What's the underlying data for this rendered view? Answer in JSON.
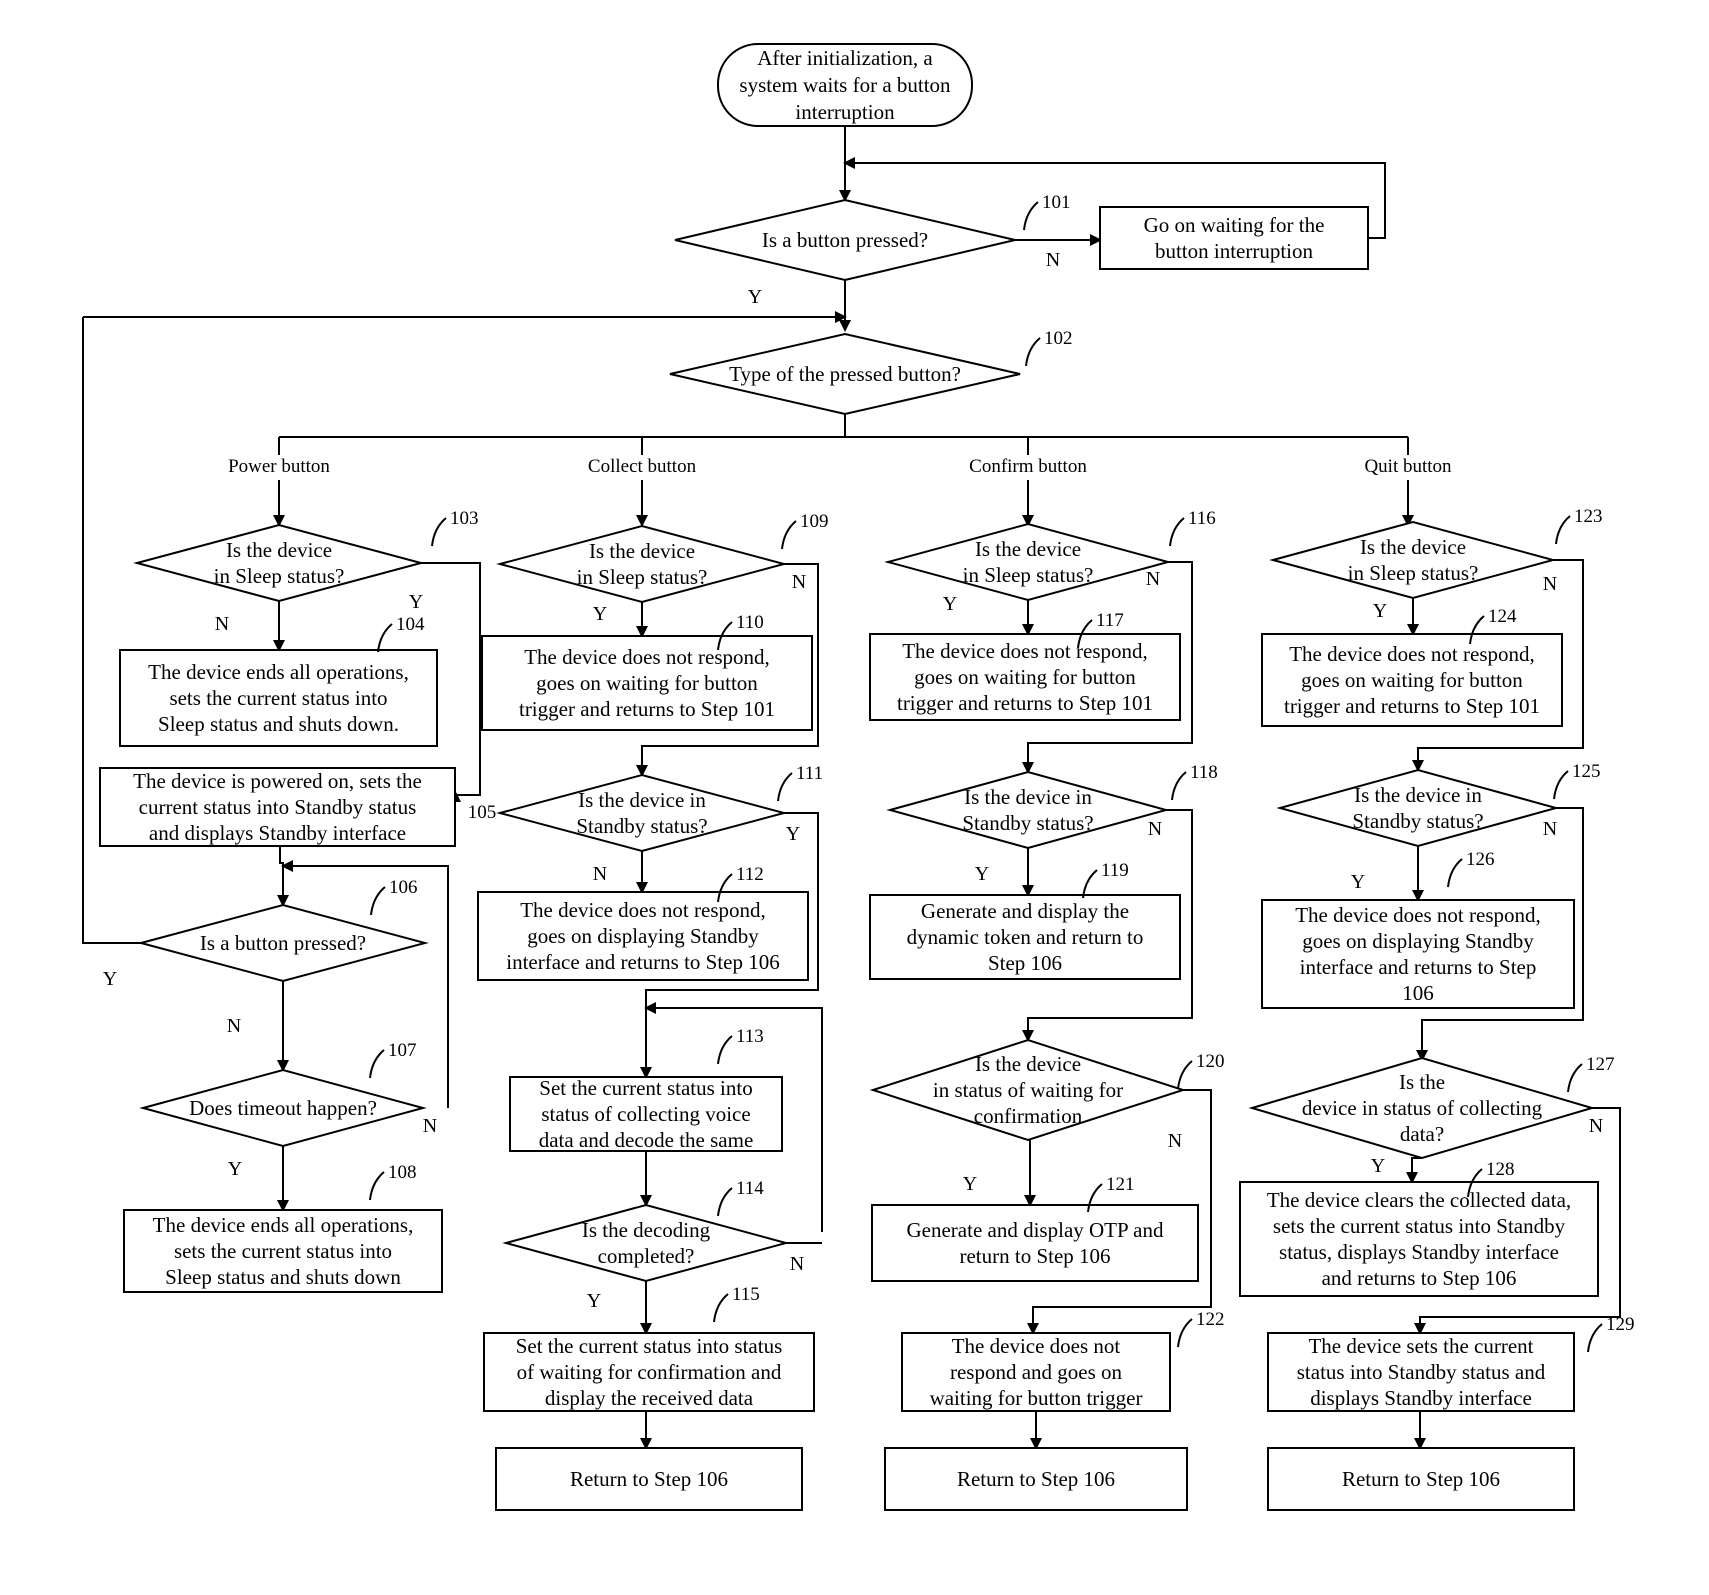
{
  "diagram": {
    "start": {
      "lines": [
        "After initialization, a",
        "system waits for a button",
        "interruption"
      ]
    },
    "n101": {
      "ref": "101",
      "lines": [
        "Is a button pressed?"
      ]
    },
    "wait": {
      "lines": [
        "Go on waiting for the",
        "button interruption"
      ]
    },
    "n102": {
      "ref": "102",
      "lines": [
        "Type of the pressed button?"
      ]
    },
    "branches": {
      "power": "Power button",
      "collect": "Collect button",
      "confirm": "Confirm button",
      "quit": "Quit button"
    },
    "n103": {
      "ref": "103",
      "lines": [
        "Is the device",
        "in Sleep status?"
      ]
    },
    "n104": {
      "ref": "104",
      "lines": [
        "The device ends all operations,",
        "sets the current status into",
        "Sleep status and shuts down."
      ]
    },
    "n105": {
      "ref": "105",
      "lines": [
        "The device is powered on, sets the",
        "current status into Standby status",
        "and displays Standby interface"
      ]
    },
    "n106": {
      "ref": "106",
      "lines": [
        "Is a button pressed?"
      ]
    },
    "n107": {
      "ref": "107",
      "lines": [
        "Does timeout happen?"
      ]
    },
    "n108": {
      "ref": "108",
      "lines": [
        "The device ends all operations,",
        "sets the current status into",
        "Sleep status and shuts down"
      ]
    },
    "n109": {
      "ref": "109",
      "lines": [
        "Is the device",
        "in Sleep status?"
      ]
    },
    "n110": {
      "ref": "110",
      "lines": [
        "The device does not respond,",
        "goes on waiting for button",
        "trigger and returns to Step 101"
      ]
    },
    "n111": {
      "ref": "111",
      "lines": [
        "Is the device in",
        "Standby status?"
      ]
    },
    "n112": {
      "ref": "112",
      "lines": [
        "The device does not respond,",
        "goes on displaying Standby",
        "interface and returns to Step 106"
      ]
    },
    "n113": {
      "ref": "113",
      "lines": [
        "Set the current status into",
        "status of collecting voice",
        "data and decode the same"
      ]
    },
    "n114": {
      "ref": "114",
      "lines": [
        "Is the decoding",
        "completed?"
      ]
    },
    "n115": {
      "ref": "115",
      "lines": [
        "Set the current status into status",
        "of waiting for confirmation and",
        "display the received data"
      ]
    },
    "ret1": {
      "lines": [
        "Return to Step 106"
      ]
    },
    "n116": {
      "ref": "116",
      "lines": [
        "Is the device",
        "in Sleep status?"
      ]
    },
    "n117": {
      "ref": "117",
      "lines": [
        "The device does not respond,",
        "goes on waiting for button",
        "trigger and returns to Step 101"
      ]
    },
    "n118": {
      "ref": "118",
      "lines": [
        "Is the device in",
        "Standby status?"
      ]
    },
    "n119": {
      "ref": "119",
      "lines": [
        "Generate and display the",
        "dynamic token and  return to",
        "Step 106"
      ]
    },
    "n120": {
      "ref": "120",
      "lines": [
        "Is the device",
        "in status of waiting for",
        "confirmation"
      ]
    },
    "n121": {
      "ref": "121",
      "lines": [
        "Generate and display  OTP  and",
        "return to Step 106"
      ]
    },
    "n122": {
      "ref": "122",
      "lines": [
        "The device does not",
        "respond and goes on",
        "waiting for button trigger"
      ]
    },
    "ret2": {
      "lines": [
        "Return to Step 106"
      ]
    },
    "n123": {
      "ref": "123",
      "lines": [
        "Is the device",
        "in Sleep status?"
      ]
    },
    "n124": {
      "ref": "124",
      "lines": [
        "The device does not respond,",
        "goes on waiting for button",
        "trigger and returns to Step 101"
      ]
    },
    "n125": {
      "ref": "125",
      "lines": [
        "Is the device in",
        "Standby status?"
      ]
    },
    "n126": {
      "ref": "126",
      "lines": [
        "The device does not respond,",
        "goes on displaying Standby",
        "interface and returns to Step",
        "106"
      ]
    },
    "n127": {
      "ref": "127",
      "lines": [
        "Is the",
        "device  in status of collecting",
        "data?"
      ]
    },
    "n128": {
      "ref": "128",
      "lines": [
        "The device clears the collected data,",
        "sets the current status into Standby",
        "status, displays Standby interface",
        "and returns to Step 106"
      ]
    },
    "n129": {
      "ref": "129",
      "lines": [
        "The device sets the current",
        "status into Standby status and",
        "displays Standby interface"
      ]
    },
    "ret3": {
      "lines": [
        "Return to Step 106"
      ]
    },
    "labels": {
      "yes": "Y",
      "no": "N"
    }
  }
}
